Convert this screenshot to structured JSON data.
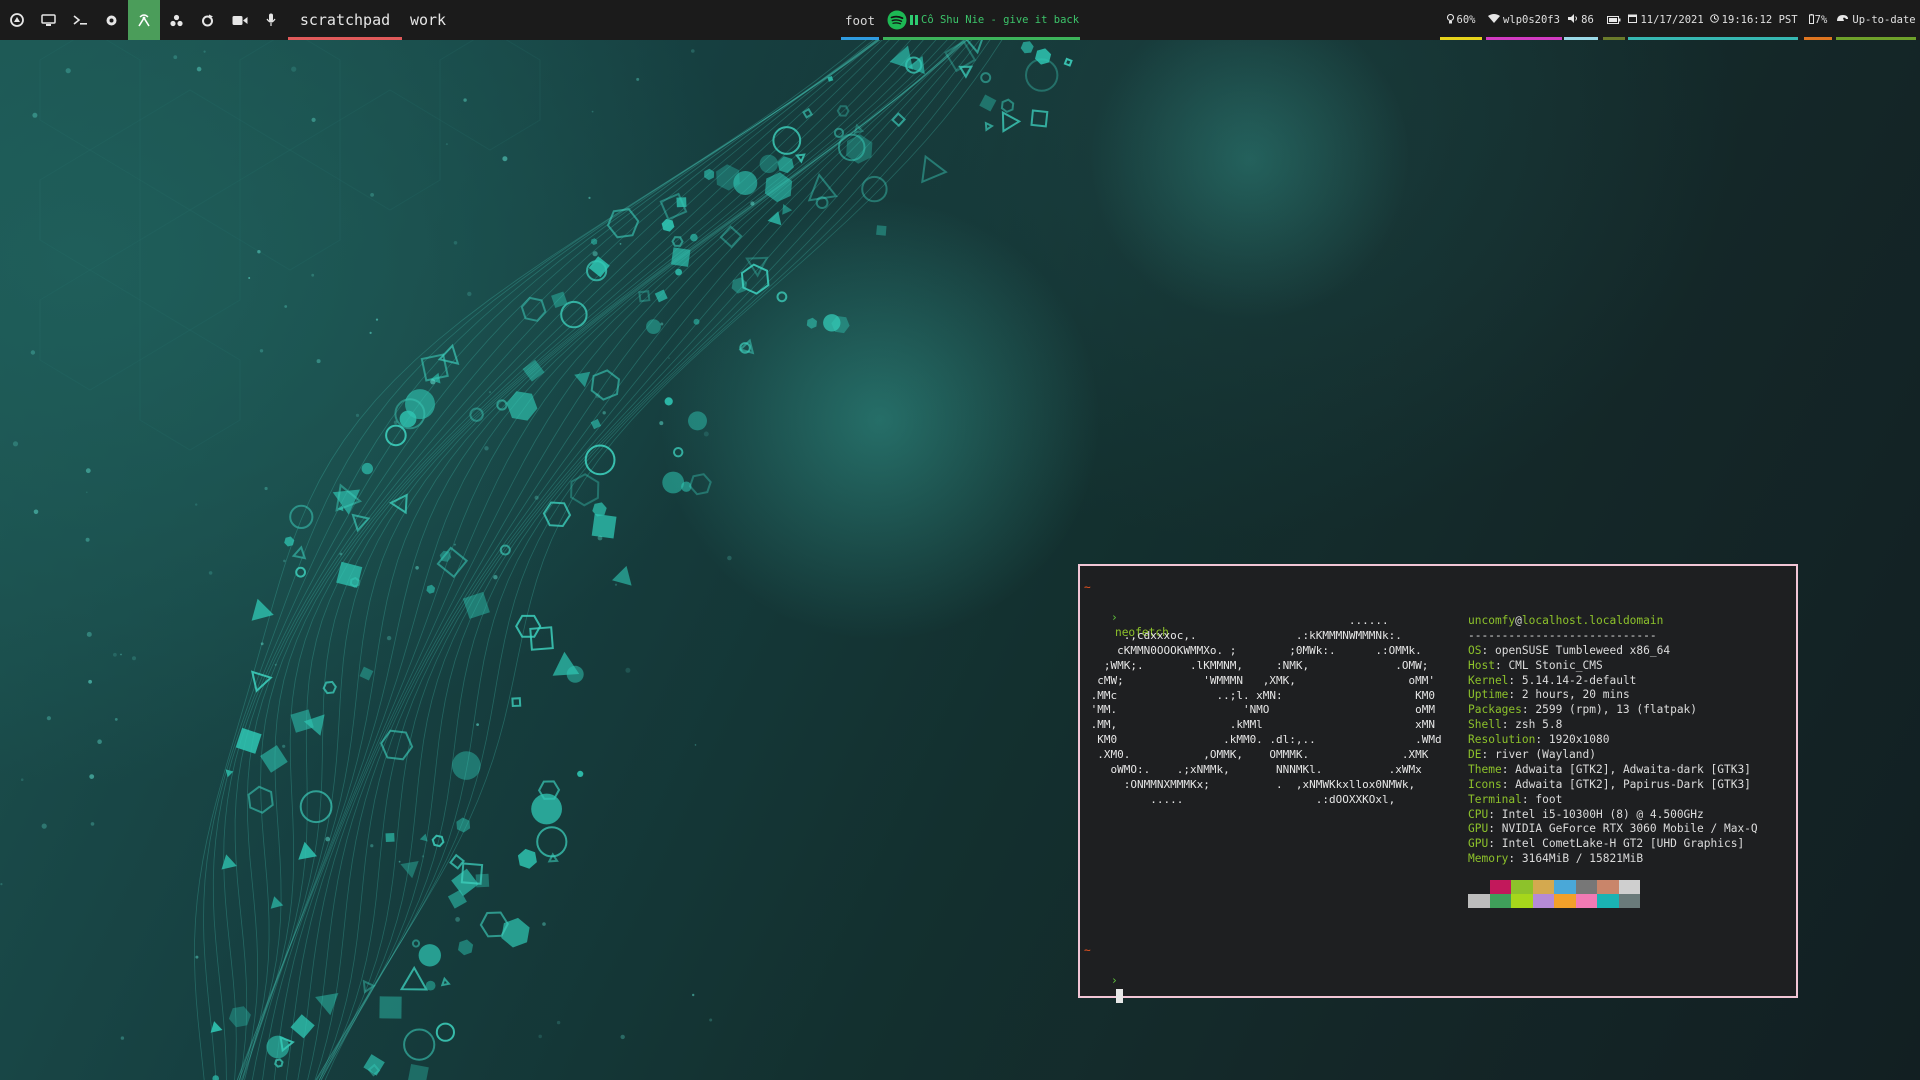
{
  "topbar": {
    "left_icons": [
      {
        "name": "launcher-icon"
      },
      {
        "name": "monitor-icon"
      },
      {
        "name": "terminal-prompt-icon"
      },
      {
        "name": "settings-gear-icon"
      },
      {
        "name": "wireless-antenna-icon",
        "active": true
      },
      {
        "name": "cluster-icon"
      },
      {
        "name": "circular-arrow-icon"
      },
      {
        "name": "video-camera-icon"
      },
      {
        "name": "microphone-icon"
      }
    ],
    "workspaces": [
      {
        "label": "scratchpad",
        "active": true
      },
      {
        "label": "work"
      }
    ],
    "focused_app": "foot",
    "media": {
      "track": "Cô Shu Nie - give it back",
      "state": "paused"
    },
    "status": {
      "brightness": "60%",
      "network": "wlp0s20f3",
      "volume": "86",
      "date": "11/17/2021",
      "time": "19:16:12 PST",
      "battery": "7%",
      "updates": "Up-to-date"
    },
    "colors": {
      "bar_bg": "#1b1b1b",
      "active_module": "#4b9d5a",
      "workspace_underline": "#e05a5a",
      "title_underline": "#2f9be0",
      "media_underline": "#3cb35a",
      "brightness_underline": "#e6d21b",
      "network_underline": "#d23bc2",
      "volume_underline": "#9ad8e6",
      "audio_underline": "#6a7a2a",
      "datetime_underline": "#36b7b1",
      "battery_underline": "#e07520",
      "updates_underline": "#6ea02a"
    }
  },
  "terminal": {
    "border_color": "#f2c6d6",
    "prompt_tilde": "~",
    "prompt_symbol": "›",
    "command": "neofetch",
    "ascii_art": "                                        ......\n      .,cdxxxoc,.               .:kKMMMNWMMMNk:.\n     cKMMN0OOOKWMMXo. ;        ;0MWk:.      .:OMMk.\n   ;WMK;.       .lKMMNM,     :NMK,             .OMW;\n  cMW;            'WMMMN   ,XMK,                 oMM'\n .MMc               ..;l. xMN:                    KM0\n 'MM.                   'NMO                      oMM\n .MM,                 .kMMl                       xMN\n  KM0                .kMM0. .dl:,..               .WMd\n  .XM0.           ,OMMK,    OMMMK.              .XMK\n    oWMO:.    .;xNMMk,       NNNMKl.          .xWMx\n      :ONMMNXMMMKx;          .  ,xNMWKkxllox0NMWk,\n          .....                    .:dOOXXKOxl,",
    "user": "uncomfy",
    "at": "@",
    "host": "localhost.localdomain",
    "separator": "----------------------------",
    "info": [
      {
        "key": "OS",
        "value": "openSUSE Tumbleweed x86_64"
      },
      {
        "key": "Host",
        "value": "CML Stonic_CMS"
      },
      {
        "key": "Kernel",
        "value": "5.14.14-2-default"
      },
      {
        "key": "Uptime",
        "value": "2 hours, 20 mins"
      },
      {
        "key": "Packages",
        "value": "2599 (rpm), 13 (flatpak)"
      },
      {
        "key": "Shell",
        "value": "zsh 5.8"
      },
      {
        "key": "Resolution",
        "value": "1920x1080"
      },
      {
        "key": "DE",
        "value": "river (Wayland)"
      },
      {
        "key": "Theme",
        "value": "Adwaita [GTK2], Adwaita-dark [GTK3]"
      },
      {
        "key": "Icons",
        "value": "Adwaita [GTK2], Papirus-Dark [GTK3]"
      },
      {
        "key": "Terminal",
        "value": "foot"
      },
      {
        "key": "CPU",
        "value": "Intel i5-10300H (8) @ 4.500GHz"
      },
      {
        "key": "GPU",
        "value": "NVIDIA GeForce RTX 3060 Mobile / Max-Q"
      },
      {
        "key": "GPU",
        "value": "Intel CometLake-H GT2 [UHD Graphics]"
      },
      {
        "key": "Memory",
        "value": "3164MiB / 15821MiB"
      }
    ],
    "palette_row1": [
      "#1e1f21",
      "#c2185b",
      "#8dc22b",
      "#d4a94f",
      "#4aa8d8",
      "#777777",
      "#c9856a",
      "#cfcfcf"
    ],
    "palette_row2": [
      "#bdbdbd",
      "#3f9f5a",
      "#a6d61b",
      "#b58ad6",
      "#f2a02a",
      "#f27ab4",
      "#1ab3b3",
      "#6a7a7a"
    ]
  }
}
